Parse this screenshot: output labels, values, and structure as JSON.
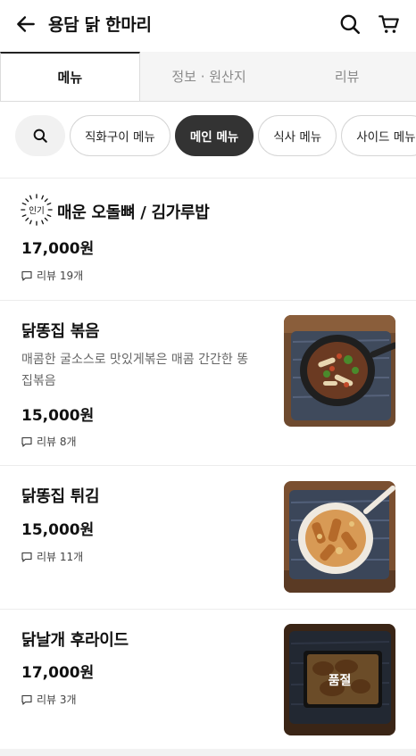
{
  "header": {
    "title": "용담 닭 한마리",
    "back_icon": "arrow-left-icon",
    "search_icon": "search-icon",
    "cart_icon": "cart-icon"
  },
  "tabs": [
    {
      "label": "메뉴",
      "active": true
    },
    {
      "label": "정보 · 원산지",
      "active": false
    },
    {
      "label": "리뷰",
      "active": false
    }
  ],
  "chips": [
    {
      "label": "직화구이 메뉴",
      "active": false
    },
    {
      "label": "메인 메뉴",
      "active": true
    },
    {
      "label": "식사 메뉴",
      "active": false
    },
    {
      "label": "사이드 메뉴",
      "active": false
    }
  ],
  "menu_items": [
    {
      "badge": "인기",
      "name": "매운 오돌뼈 / 김가루밥",
      "price": "17,000원",
      "review": "리뷰 19개"
    },
    {
      "name": "닭똥집 볶음",
      "description": "매콤한 굴소스로 맛있게볶은 매콤 간간한 똥집볶음",
      "price": "15,000원",
      "review": "리뷰 8개"
    },
    {
      "name": "닭똥집 튀김",
      "price": "15,000원",
      "review": "리뷰 11개"
    },
    {
      "name": "닭날개 후라이드",
      "price": "17,000원",
      "review": "리뷰 3개",
      "status": "품절"
    }
  ],
  "colors": {
    "active_chip": "#333333",
    "border": "#dcdcdc",
    "text_secondary": "#666666"
  }
}
